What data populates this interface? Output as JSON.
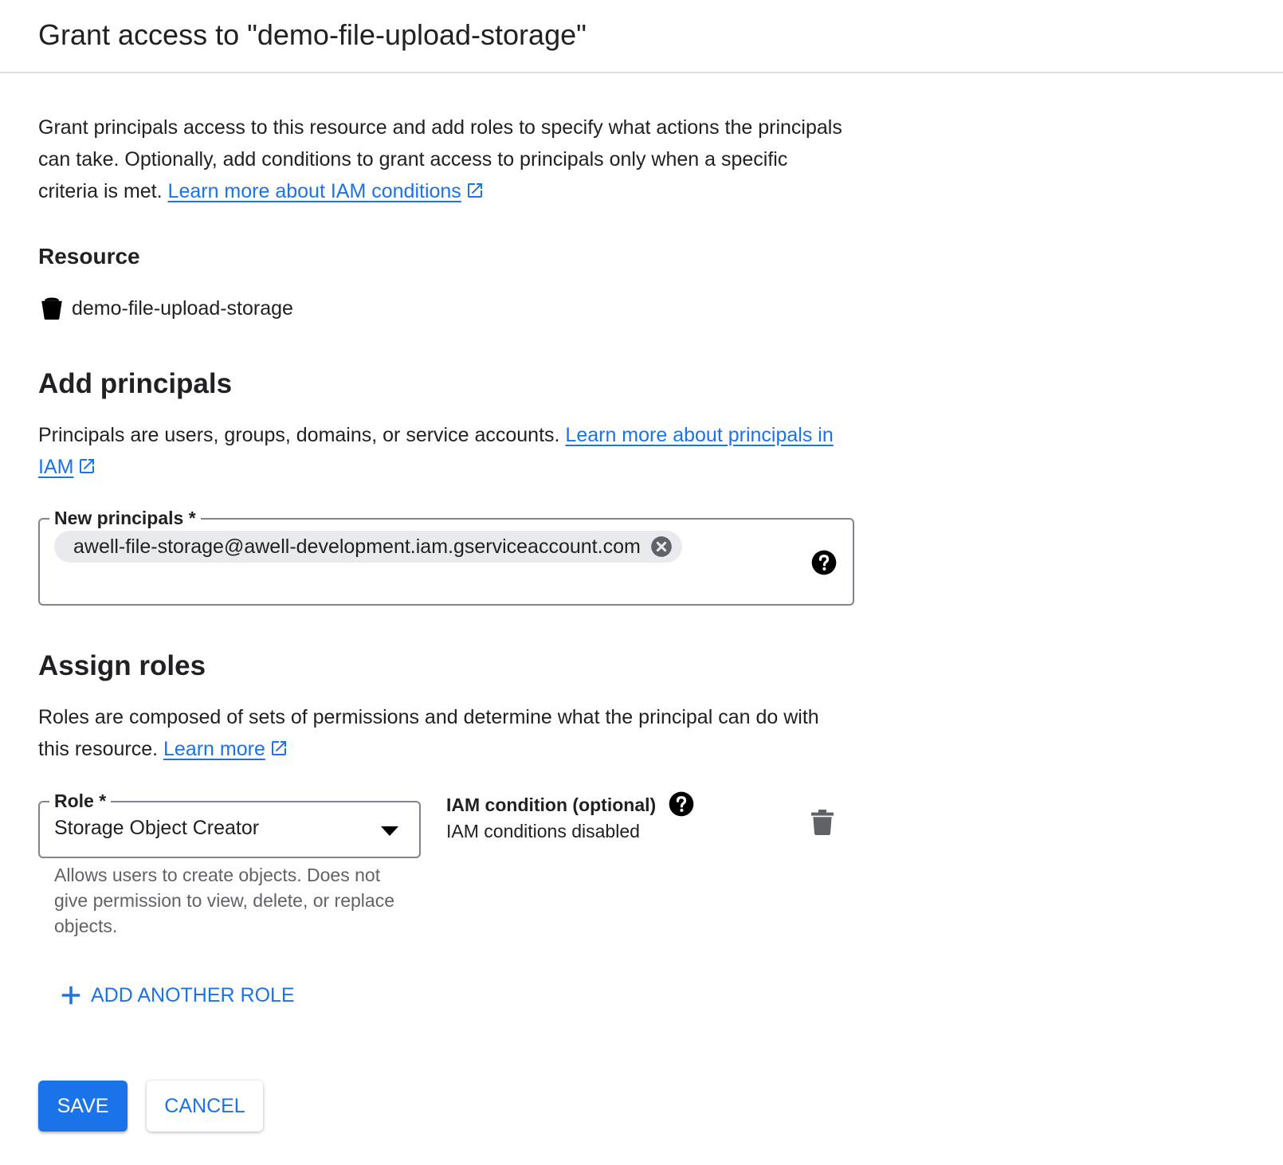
{
  "header": {
    "title": "Grant access to \"demo-file-upload-storage\""
  },
  "intro": {
    "text": "Grant principals access to this resource and add roles to specify what actions the principals can take. Optionally, add conditions to grant access to principals only when a specific criteria is met.",
    "link_label": "Learn more about IAM conditions"
  },
  "resource": {
    "label": "Resource",
    "name": "demo-file-upload-storage",
    "icon": "bucket-icon"
  },
  "add_principals": {
    "title": "Add principals",
    "text": "Principals are users, groups, domains, or service accounts.",
    "link_label": "Learn more about principals in IAM",
    "field_label": "New principals *",
    "chips": [
      "awell-file-storage@awell-development.iam.gserviceaccount.com"
    ]
  },
  "assign_roles": {
    "title": "Assign roles",
    "text": "Roles are composed of sets of permissions and determine what the principal can do with this resource.",
    "link_label": "Learn more",
    "role_label": "Role *",
    "role_value": "Storage Object Creator",
    "role_hint": "Allows users to create objects. Does not give permission to view, delete, or replace objects.",
    "condition_label": "IAM condition (optional)",
    "condition_value": "IAM conditions disabled",
    "add_role_label": "ADD ANOTHER ROLE"
  },
  "actions": {
    "save_label": "SAVE",
    "cancel_label": "CANCEL"
  },
  "colors": {
    "accent": "#1a73e8",
    "text": "#202124",
    "muted": "#5f6368",
    "border": "#80868b"
  }
}
